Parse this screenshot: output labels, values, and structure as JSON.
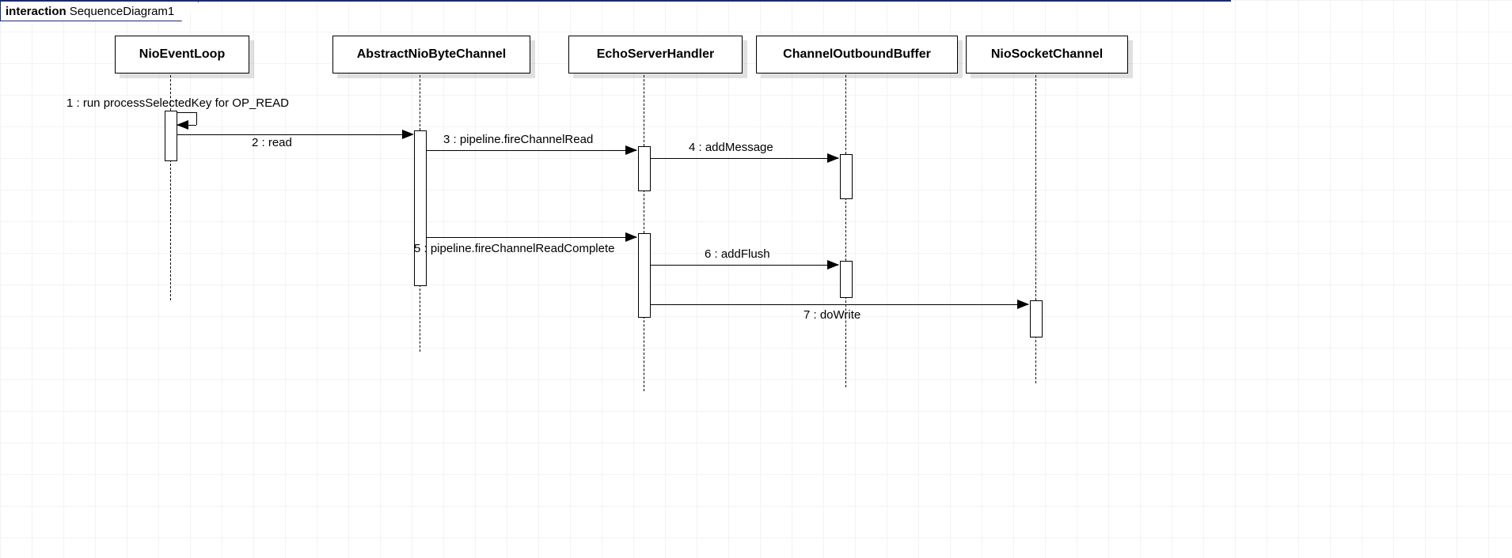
{
  "frame": {
    "kind": "interaction",
    "title": "SequenceDiagram1"
  },
  "participants": {
    "p1": "NioEventLoop",
    "p2": "AbstractNioByteChannel",
    "p3": "EchoServerHandler",
    "p4": "ChannelOutboundBuffer",
    "p5": "NioSocketChannel"
  },
  "messages": {
    "m1": "1 : run processSelectedKey for OP_READ",
    "m2": "2 : read",
    "m3": "3 : pipeline.fireChannelRead",
    "m4": "4 : addMessage",
    "m5": "5 : pipeline.fireChannelReadComplete",
    "m6": "6 : addFlush",
    "m7": "7 : doWrite"
  }
}
